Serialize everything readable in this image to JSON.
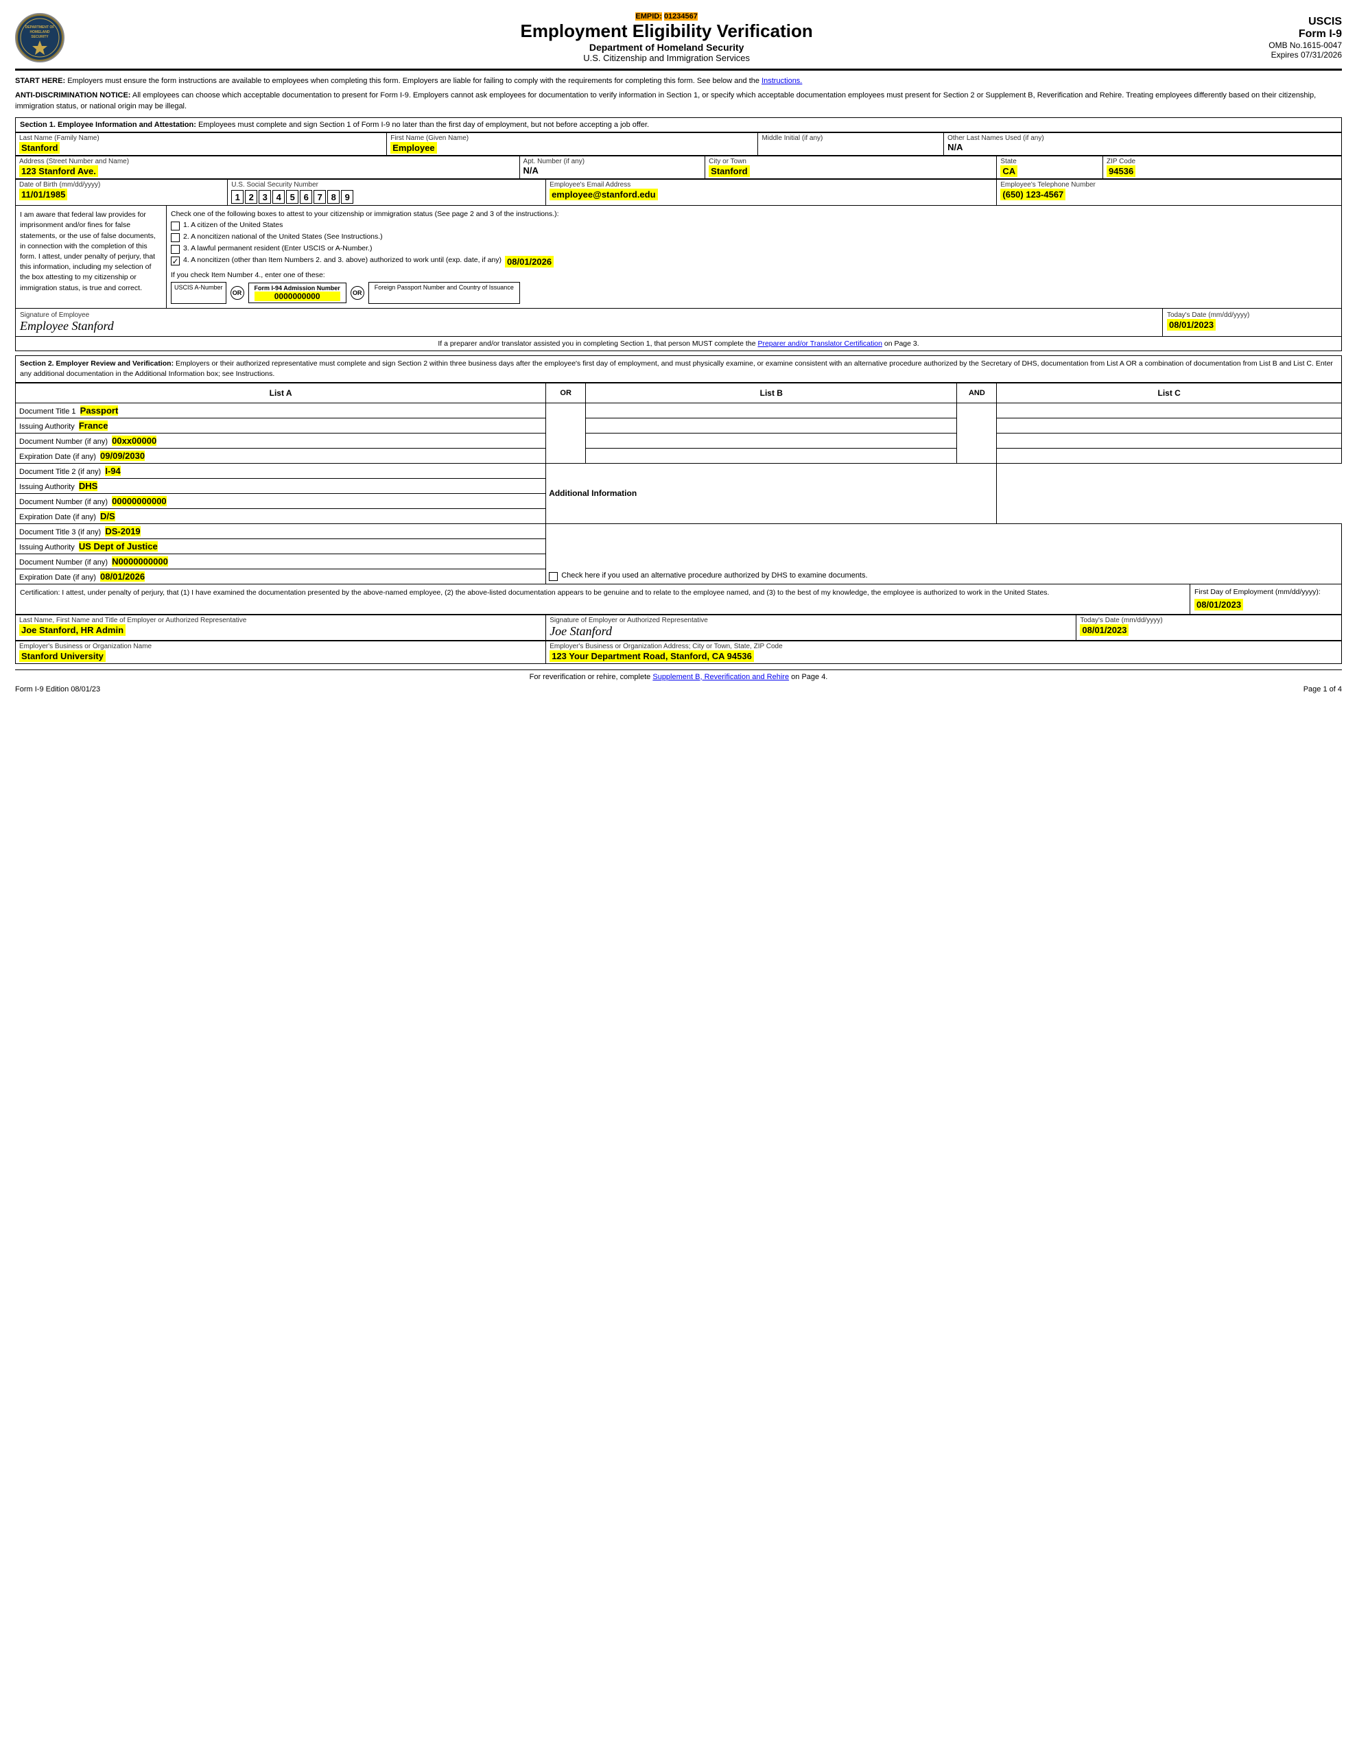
{
  "header": {
    "empid_label": "EMPID:",
    "empid_value": "01234567",
    "title": "Employment Eligibility Verification",
    "dept": "Department of Homeland Security",
    "agency": "U.S. Citizenship and Immigration Services",
    "uscis": "USCIS",
    "form": "Form I-9",
    "omb": "OMB No.1615-0047",
    "expires": "Expires 07/31/2026",
    "logo_text": "DEPT OF HOMELAND SECURITY"
  },
  "notices": {
    "start_here": "START HERE:  Employers must ensure the form instructions are available to employees when completing this form.  Employers are liable for failing to comply with the requirements for completing this form.  See below and the Instructions.",
    "anti_disc_label": "ANTI-DISCRIMINATION NOTICE:",
    "anti_disc": "All employees can choose which acceptable documentation to present for Form I-9.  Employers cannot ask employees for documentation to verify information in Section 1, or specify which acceptable documentation employees must present for Section 2 or Supplement B, Reverification and Rehire.  Treating employees differently based on their citizenship, immigration status, or national origin may be illegal."
  },
  "section1": {
    "header": "Section 1. Employee Information and Attestation:",
    "header_text": " Employees must complete and sign Section 1 of Form I-9 no later than the first day of employment, but not before accepting a job offer.",
    "last_name_label": "Last Name (Family Name)",
    "last_name": "Stanford",
    "first_name_label": "First Name (Given Name)",
    "first_name": "Employee",
    "middle_initial_label": "Middle Initial (if any)",
    "middle_initial": "",
    "other_names_label": "Other Last Names Used (if any)",
    "other_names": "N/A",
    "address_label": "Address (Street Number and Name)",
    "address": "123 Stanford Ave.",
    "apt_label": "Apt. Number (if any)",
    "apt": "N/A",
    "city_label": "City or Town",
    "city": "Stanford",
    "state_label": "State",
    "state": "CA",
    "zip_label": "ZIP Code",
    "zip": "94536",
    "dob_label": "Date of Birth (mm/dd/yyyy)",
    "dob": "11/01/1985",
    "ssn_label": "U.S. Social Security Number",
    "ssn_digits": [
      "1",
      "2",
      "3",
      "4",
      "5",
      "6",
      "7",
      "8",
      "9"
    ],
    "email_label": "Employee's Email Address",
    "email": "employee@stanford.edu",
    "phone_label": "Employee's Telephone Number",
    "phone": "(650) 123-4567",
    "attestation_text": "I am aware that federal law provides for imprisonment and/or fines for false statements, or the use of false documents, in connection with the completion of this form.  I attest, under penalty of perjury, that this information, including my selection of the box attesting to my citizenship or immigration status, is true and correct.",
    "check_intro": "Check one of the following boxes to attest to your citizenship or immigration status (See page 2 and 3 of the instructions.):",
    "box1": "1.  A citizen of the United States",
    "box2": "2.  A noncitizen national of the United States (See Instructions.)",
    "box3": "3.  A lawful permanent resident (Enter USCIS or A-Number.)",
    "box4": "4.  A noncitizen (other than Item Numbers 2. and 3. above) authorized to work until (exp. date, if any)",
    "box4_date": "08/01/2026",
    "box4_checked": true,
    "if_box4": "If you check Item Number 4., enter one of these:",
    "uscis_label": "USCIS A-Number",
    "or1": "OR",
    "i94_label": "Form I-94 Admission Number",
    "i94_value": "0000000000",
    "or2": "OR",
    "passport_label": "Foreign Passport Number and Country of Issuance",
    "sig_label": "Signature of Employee",
    "sig_value": "Employee Stanford",
    "date_label": "Today's Date (mm/dd/yyyy)",
    "date_value": "08/01/2023",
    "preparer_note": "If a preparer and/or translator assisted you in completing Section 1, that person MUST complete the Preparer and/or Translator Certification on Page 3."
  },
  "section2": {
    "header": "Section 2. Employer Review and Verification:",
    "header_text": " Employers or their authorized representative must complete and sign Section 2 within three business days after the employee's first day of employment, and must physically examine, or examine consistent with an alternative procedure authorized by the Secretary of DHS, documentation from List A OR a combination of documentation from List B and List C.  Enter any additional documentation in the Additional Information box; see Instructions.",
    "col_a": "List A",
    "col_b": "List B",
    "col_c": "List C",
    "or_label": "OR",
    "and_label": "AND",
    "doc1_title_label": "Document Title 1",
    "doc1_title": "Passport",
    "doc1_issuing_label": "Issuing Authority",
    "doc1_issuing": "France",
    "doc1_number_label": "Document Number (if any)",
    "doc1_number": "00xx00000",
    "doc1_expiry_label": "Expiration Date (if any)",
    "doc1_expiry": "09/09/2030",
    "doc2_title_label": "Document Title 2 (if any)",
    "doc2_title": "I-94",
    "additional_info_label": "Additional Information",
    "doc2_issuing_label": "Issuing Authority",
    "doc2_issuing": "DHS",
    "doc2_number_label": "Document Number (if any)",
    "doc2_number": "00000000000",
    "doc2_expiry_label": "Expiration Date (if any)",
    "doc2_expiry": "D/S",
    "doc3_title_label": "Document Title 3 (if any)",
    "doc3_title": "DS-2019",
    "doc3_issuing_label": "Issuing Authority",
    "doc3_issuing": "US Dept of Justice",
    "doc3_number_label": "Document Number (if any)",
    "doc3_number": "N0000000000",
    "doc3_expiry_label": "Expiration Date (if any)",
    "doc3_expiry": "08/01/2026",
    "alt_procedure_text": "Check here if you used an alternative procedure authorized by DHS to examine documents.",
    "cert_text": "Certification: I attest, under penalty of perjury, that (1) I have examined the documentation presented by the above-named employee, (2) the above-listed documentation appears to be genuine and to relate to the employee named, and (3) to the best of my knowledge, the employee is authorized to work in the United States.",
    "first_day_label": "First Day of Employment (mm/dd/yyyy):",
    "first_day": "08/01/2023",
    "emp_name_label": "Last Name, First Name and Title of Employer or Authorized Representative",
    "emp_name": "Joe Stanford, HR Admin",
    "emp_sig_label": "Signature of Employer or Authorized Representative",
    "emp_sig_value": "Joe Stanford",
    "emp_date_label": "Today's Date (mm/dd/yyyy)",
    "emp_date": "08/01/2023",
    "org_name_label": "Employer's Business or Organization Name",
    "org_name": "Stanford University",
    "org_address_label": "Employer's Business or Organization Address; City or Town, State, ZIP Code",
    "org_address": "123 Your Department Road, Stanford, CA 94536"
  },
  "footer": {
    "reverif_text": "For reverification or rehire, complete",
    "reverif_link": "Supplement B, Reverification and Rehire",
    "reverif_end": "on Page 4.",
    "form_edition": "Form I-9  Edition  08/01/23",
    "page_num": "Page 1 of 4"
  }
}
